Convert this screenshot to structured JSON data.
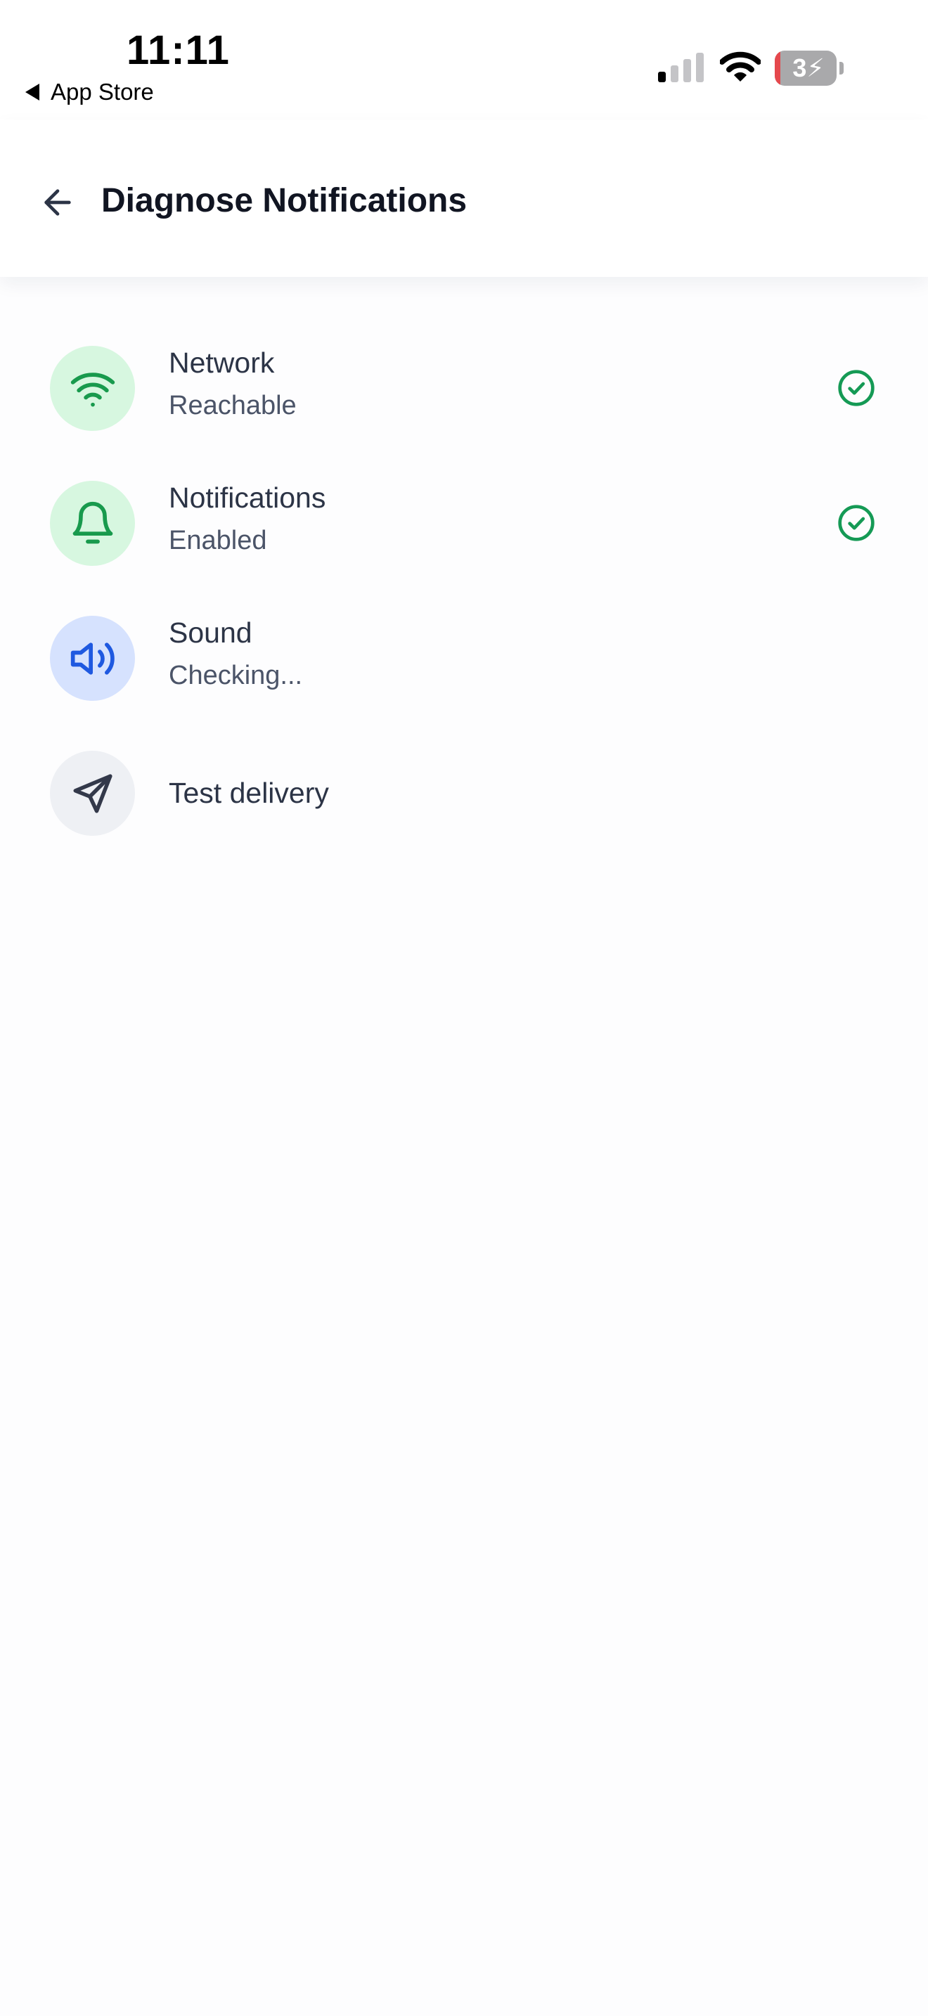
{
  "status_bar": {
    "time": "11:11",
    "back_label": "App Store",
    "battery_level": "34",
    "battery_display": "3⚡"
  },
  "header": {
    "title": "Diagnose Notifications",
    "back_icon": "arrow-left-icon"
  },
  "checks": [
    {
      "title": "Network",
      "status": "Reachable",
      "icon": "wifi-icon",
      "state": "success",
      "icon_bg": "#d7f7e0",
      "icon_color": "#189a4d"
    },
    {
      "title": "Notifications",
      "status": "Enabled",
      "icon": "bell-icon",
      "state": "success",
      "icon_bg": "#d7f7e0",
      "icon_color": "#189a4d"
    },
    {
      "title": "Sound",
      "status": "Checking...",
      "icon": "speaker-icon",
      "state": "pending",
      "icon_bg": "#d6e2fe",
      "icon_color": "#1f59e0"
    },
    {
      "title": "Test delivery",
      "status": "",
      "icon": "send-icon",
      "state": "idle",
      "icon_bg": "#eef0f4",
      "icon_color": "#33394a"
    }
  ],
  "colors": {
    "success": "#159a55",
    "text_primary": "#111522",
    "text_secondary": "#4b5468"
  }
}
